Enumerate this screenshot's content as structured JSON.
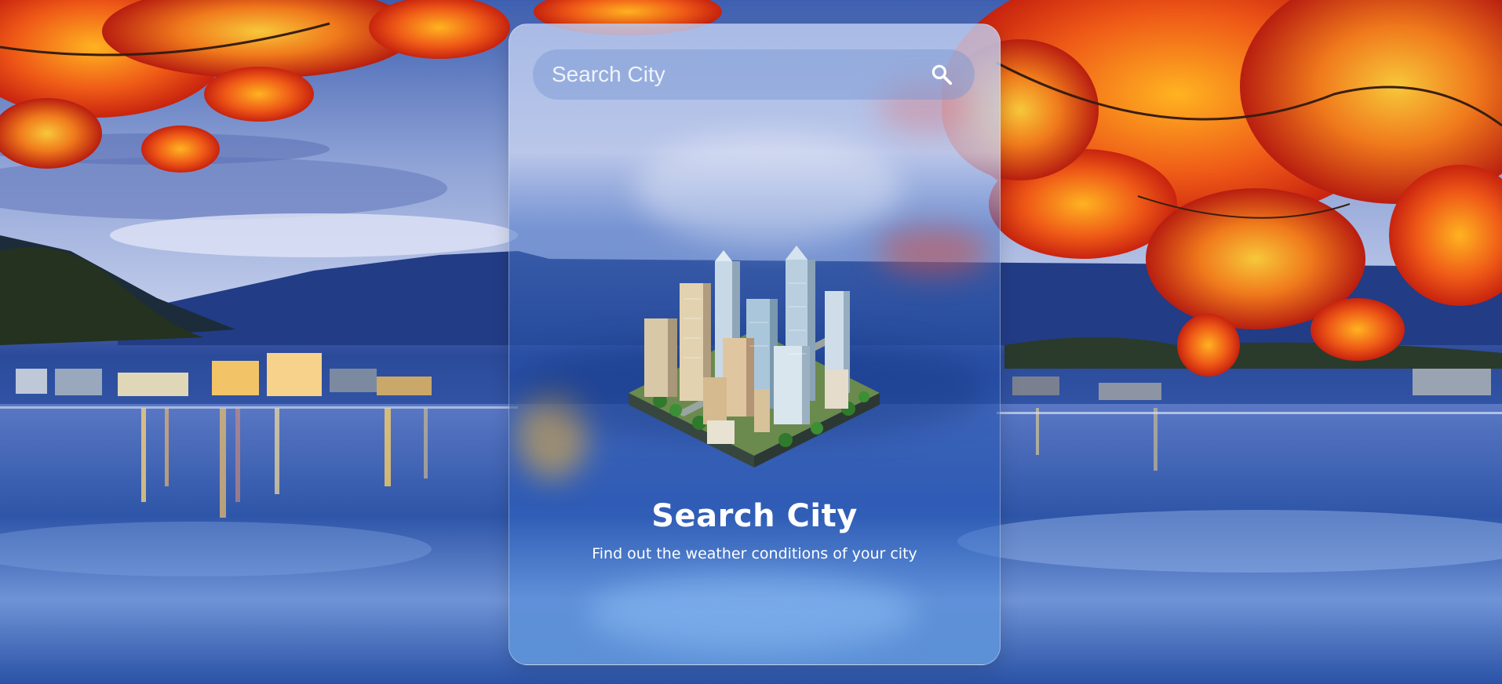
{
  "search": {
    "placeholder": "Search City",
    "icon": "search-icon"
  },
  "main": {
    "illustration_icon": "city-skyline-illustration",
    "title": "Search City",
    "subtitle": "Find out the weather conditions of your city"
  },
  "colors": {
    "text": "#ffffff",
    "leaves": "#e8501a",
    "water": "#2a4c9c",
    "sky": "#a8b6dc"
  }
}
